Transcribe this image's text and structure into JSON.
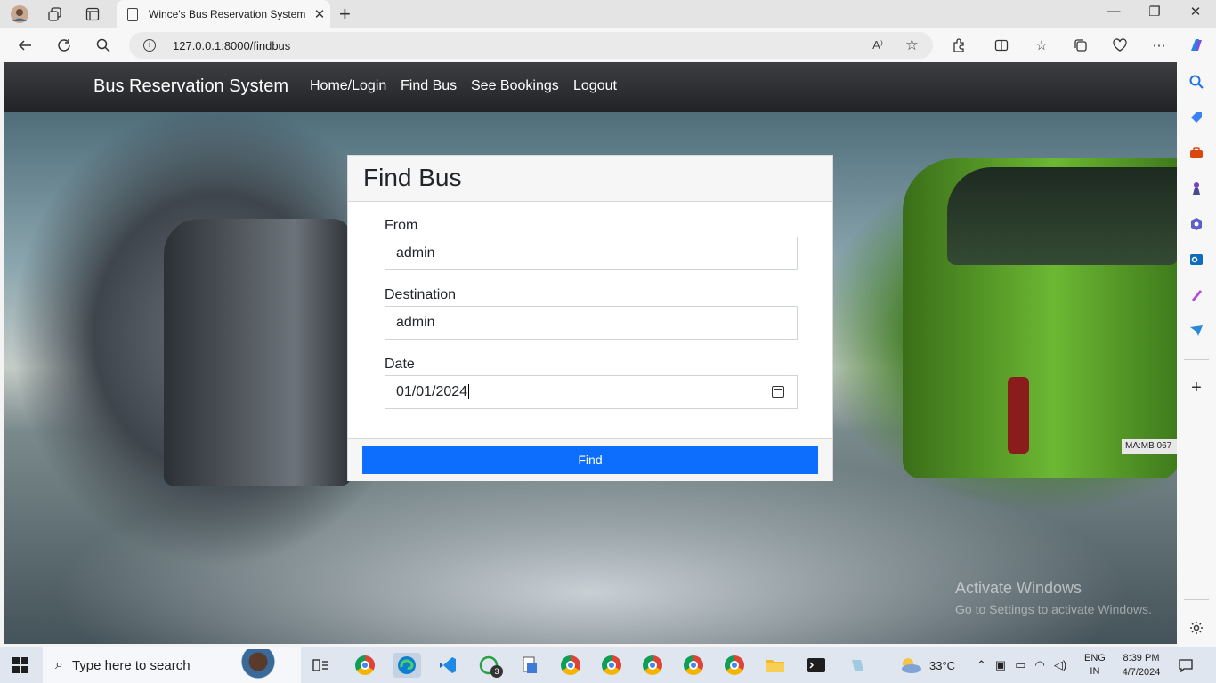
{
  "browser": {
    "tab_title": "Wince's Bus Reservation System",
    "tab_close": "✕",
    "new_tab": "+",
    "url": "127.0.0.1:8000/findbus",
    "read_aloud": "A⁾"
  },
  "navbar": {
    "brand": "Bus Reservation System",
    "links": [
      "Home/Login",
      "Find Bus",
      "See Bookings",
      "Logout"
    ]
  },
  "form": {
    "title": "Find Bus",
    "from_label": "From",
    "from_value": "admin",
    "destination_label": "Destination",
    "destination_value": "admin",
    "date_label": "Date",
    "date_value": "01/01/2024",
    "submit_label": "Find"
  },
  "background": {
    "plate_text": "MA:MB 067"
  },
  "watermark": {
    "line1": "Activate Windows",
    "line2": "Go to Settings to activate Windows."
  },
  "taskbar": {
    "search_placeholder": "Type here to search",
    "whatsapp_badge": "3",
    "weather_temp": "33°C",
    "lang_line1": "ENG",
    "lang_line2": "IN",
    "time": "8:39 PM",
    "date": "4/7/2024"
  },
  "colors": {
    "primary_button": "#0d6efd",
    "navbar_dark": "#2b2c30"
  }
}
